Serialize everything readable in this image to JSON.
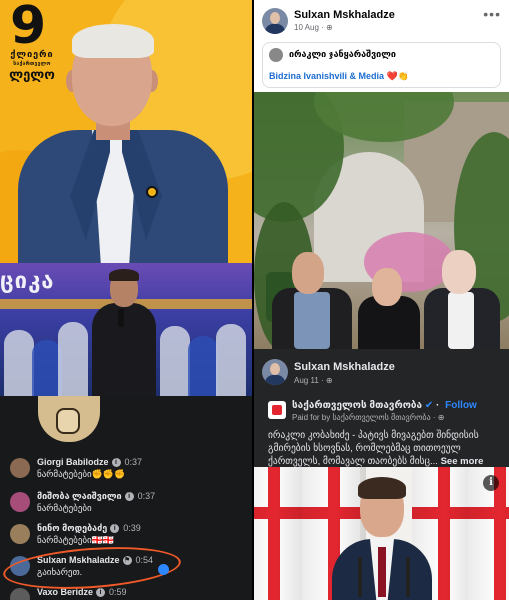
{
  "poster": {
    "number": "9",
    "party_line1": "ქლიერი",
    "party_line2": "საქართველო",
    "party_line3": "ლელო",
    "accent_color": "#f6b21b"
  },
  "stage": {
    "sign_text": "ციკა"
  },
  "comments": [
    {
      "name": "Giorgi Babilodze",
      "time": "0:37",
      "text": "ნარმატებები✊✊✊",
      "avatar_color": "#8a6a52"
    },
    {
      "name": "მიშობა ლაიშვილი",
      "time": "0:37",
      "text": "ნარმატებები",
      "avatar_color": "#a64e79"
    },
    {
      "name": "ნინო მოდებაძე",
      "time": "0:39",
      "text": "ნარმატებები🇬🇪🇬🇪",
      "avatar_color": "#9a7f5d"
    },
    {
      "name": "Sulxan Mskhaladze",
      "time": "0:54",
      "text": "გაიხარეთ.",
      "avatar_color": "#4b6a9a"
    },
    {
      "name": "Vaxo Beridze",
      "time": "0:59",
      "text": "",
      "avatar_color": "#5c5c5c"
    }
  ],
  "fb_post": {
    "author": "Sulxan Mskhaladze",
    "date": "10 Aug",
    "card_title": "ირაკლი ჯანყარაშვილი",
    "card_text": "Bidzina Ivanishvili & Media ❤️👏"
  },
  "sponsored_post": {
    "author": "Sulxan Mskhaladze",
    "date": "Aug 11",
    "page_name": "საქართველოს მთავრობა",
    "follow_label": "Follow",
    "paid_text": "Paid for by საქართველოს მთავრობა",
    "body": "ირაკლი კობახიძე - პატივს მივაგებთ შინდისის გმირების ხსოვნას, რომლებმაც თითოეულ ქართველს, მომავალ თაობებს მისც...",
    "see_more": "See more"
  },
  "flags_photo": {
    "info_symbol": "i"
  }
}
